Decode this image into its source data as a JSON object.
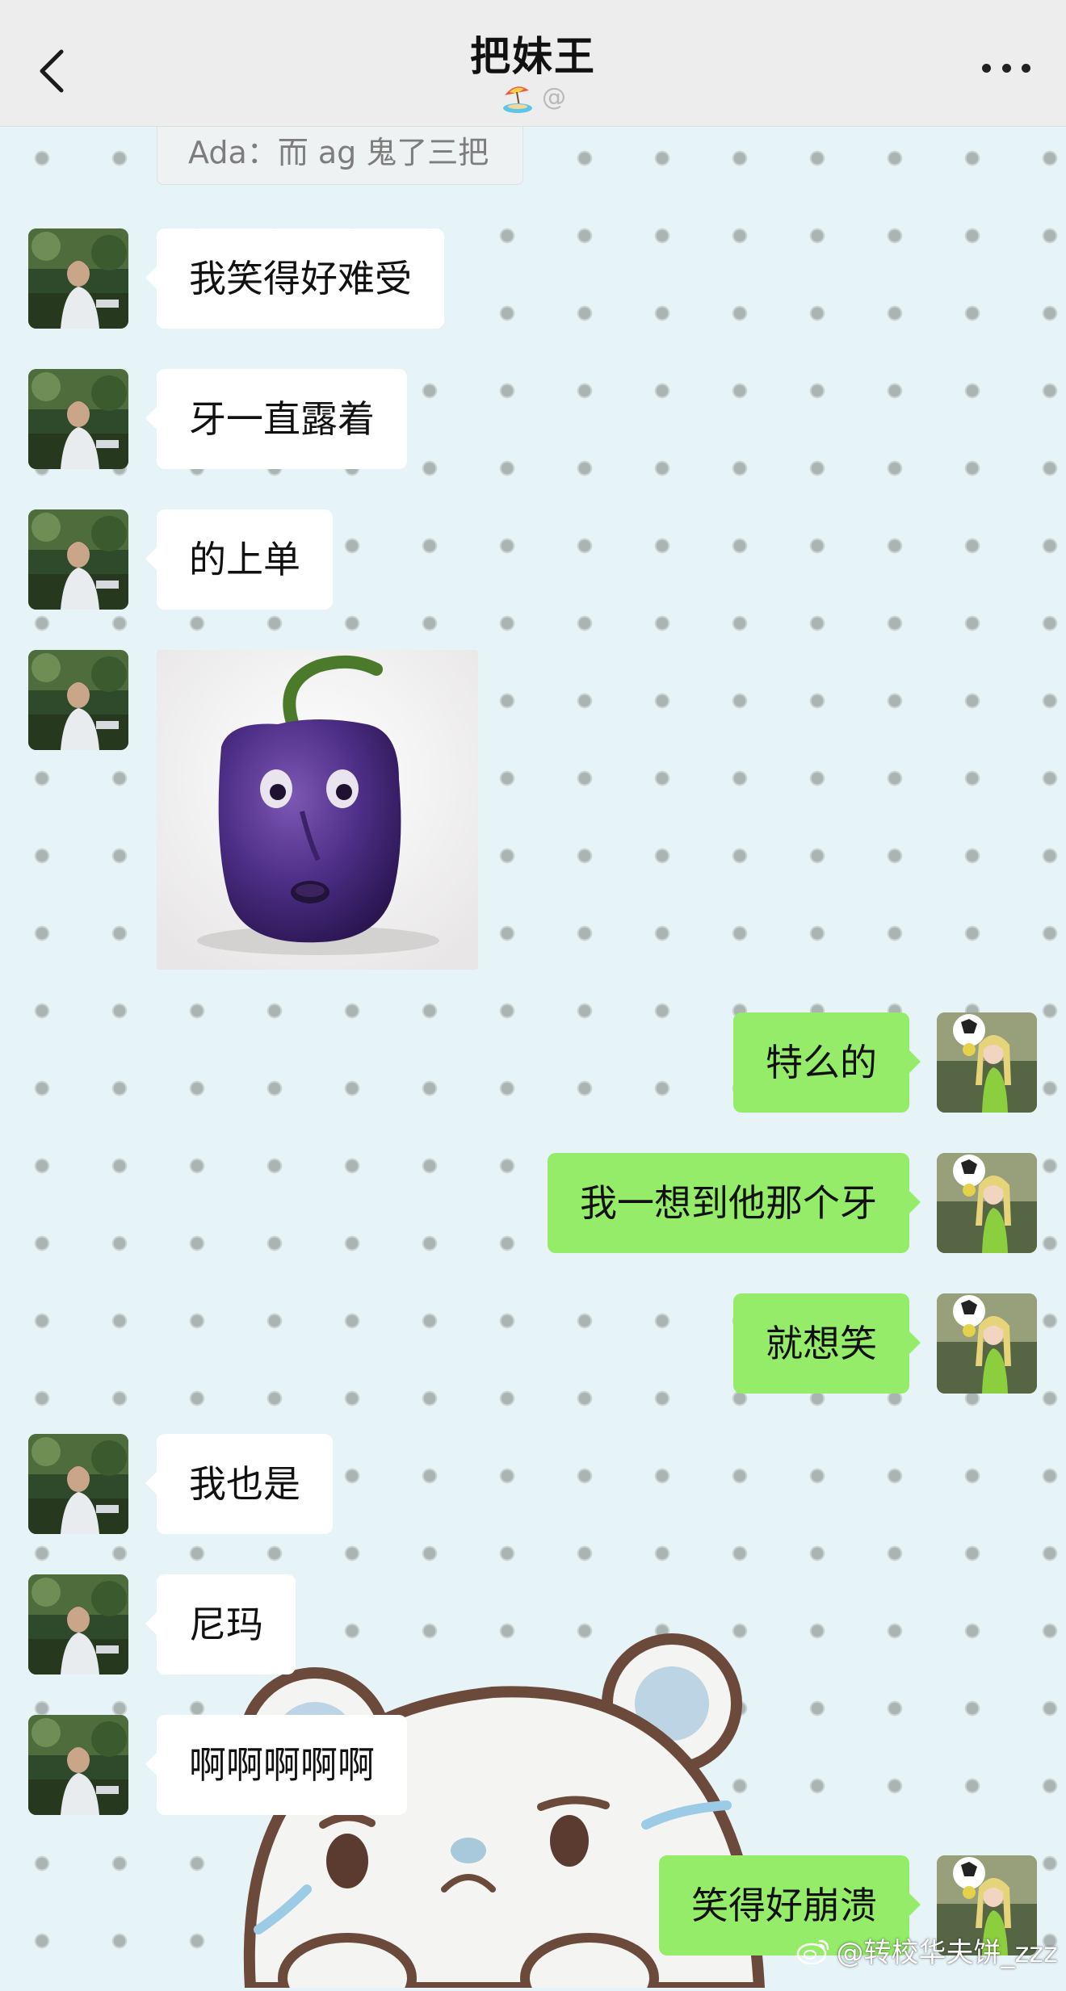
{
  "header": {
    "title": "把妹王",
    "subtitle_symbol": "@",
    "back_icon": "chevron-left-icon",
    "more_icon": "ellipsis-icon",
    "status_icon": "beach-umbrella-icon"
  },
  "quote": {
    "text": "Ada：而 ag 鬼了三把"
  },
  "messages": [
    {
      "side": "in",
      "text": "我笑得好难受"
    },
    {
      "side": "in",
      "text": "牙一直露着"
    },
    {
      "side": "in",
      "text": "的上单"
    },
    {
      "side": "in",
      "type": "image",
      "description": "purple-pepper-face-sticker"
    },
    {
      "side": "out",
      "text": "特么的"
    },
    {
      "side": "out",
      "text": "我一想到他那个牙"
    },
    {
      "side": "out",
      "text": "就想笑"
    },
    {
      "side": "in",
      "text": "我也是"
    },
    {
      "side": "in",
      "text": "尼玛"
    },
    {
      "side": "in",
      "text": "啊啊啊啊啊"
    },
    {
      "side": "out",
      "text": "笑得好崩溃"
    }
  ],
  "watermark": {
    "text": "@转校华夫饼_zzz"
  },
  "colors": {
    "header_bg": "#ededed",
    "chat_bg": "#e6f4f8",
    "incoming_bubble": "#ffffff",
    "outgoing_bubble": "#95ec69"
  }
}
